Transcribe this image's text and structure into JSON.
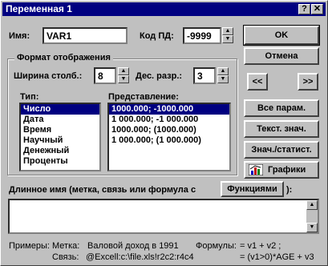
{
  "window": {
    "title": "Переменная 1",
    "help_btn": "?",
    "close_btn": "✕"
  },
  "name": {
    "label": "Имя:",
    "value": "VAR1"
  },
  "missing": {
    "label": "Код ПД:",
    "value": "-9999"
  },
  "format": {
    "group_title": "Формат отображения",
    "width_label": "Ширина столб.:",
    "width_value": "8",
    "decimals_label": "Дес. разр.:",
    "decimals_value": "3",
    "type_label": "Тип:",
    "types": [
      "Число",
      "Дата",
      "Время",
      "Научный",
      "Денежный",
      "Проценты"
    ],
    "repr_label": "Представление:",
    "reprs": [
      "1000.000; -1000.000",
      "1 000.000; -1 000.000",
      "1000.000; (1000.000)",
      "1 000.000; (1 000.000)"
    ]
  },
  "buttons": {
    "ok": "OK",
    "cancel": "Отмена",
    "prev": "<<",
    "next": ">>",
    "all_params": "Все парам.",
    "text_values": "Текст. знач.",
    "values_stats": "Знач./статист.",
    "graphs": "Графики",
    "functions": "Функциями"
  },
  "long_name": {
    "label": "Длинное имя (метка, связь или формула с",
    "suffix": "):",
    "value": ""
  },
  "examples": {
    "prefix": "Примеры:",
    "label_tag": "Метка:",
    "label_value": "Валовой доход в 1991",
    "link_tag": "Связь:",
    "link_value": "@Excell:c:\\file.xls!r2c2:r4c4",
    "formulas_tag": "Формулы:",
    "formula1": "= v1 + v2 ;",
    "formula2": "= (v1>0)*AGE + v3"
  }
}
